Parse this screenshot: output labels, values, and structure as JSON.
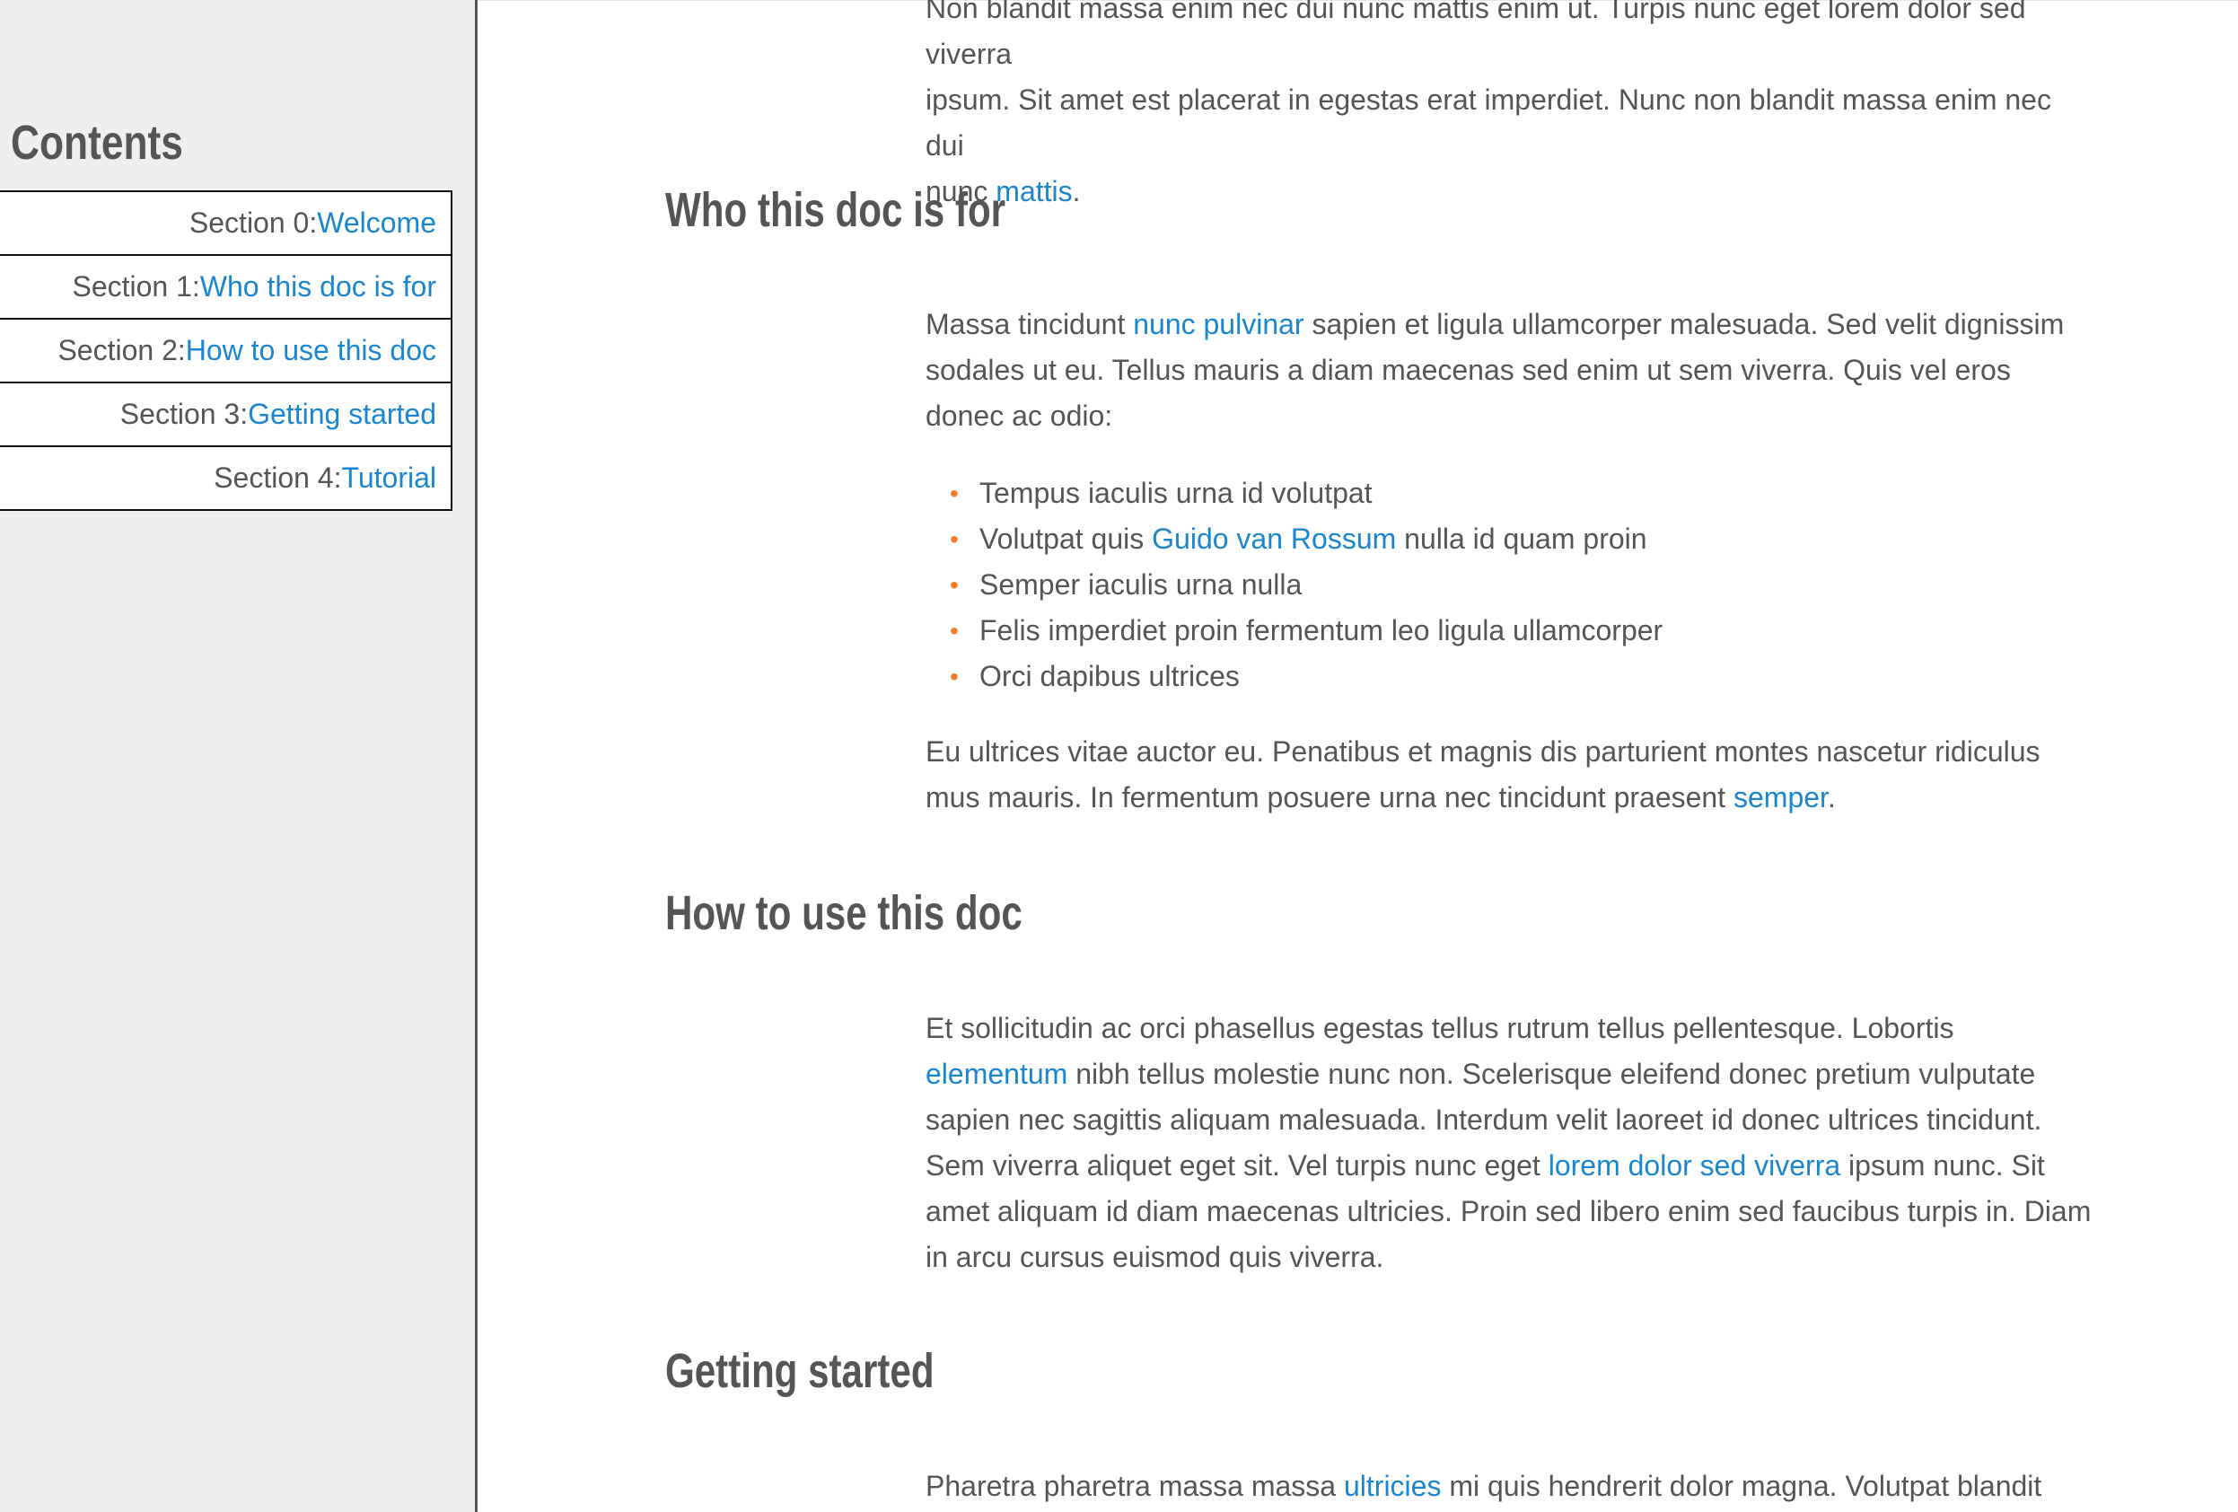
{
  "sidebar": {
    "title": "Contents",
    "items": [
      {
        "prefix": "Section 0: ",
        "link": "Welcome"
      },
      {
        "prefix": "Section 1: ",
        "link": "Who this doc is for"
      },
      {
        "prefix": "Section 2: ",
        "link": "How to use this doc"
      },
      {
        "prefix": "Section 3: ",
        "link": "Getting started"
      },
      {
        "prefix": "Section 4: ",
        "link": "Tutorial"
      }
    ]
  },
  "main": {
    "intro": {
      "line1": "Non blandit massa enim nec dui nunc mattis enim ut. Turpis nunc eget lorem dolor sed viverra",
      "line2": "ipsum. Sit amet est placerat in egestas erat imperdiet. Nunc non blandit massa enim nec dui",
      "line3_pre": "nunc ",
      "line3_link": "mattis",
      "line3_post": "."
    },
    "who": {
      "heading": "Who this doc is for",
      "p1_pre": "Massa tincidunt ",
      "p1_link": "nunc pulvinar",
      "p1_post": " sapien et ligula ullamcorper malesuada. Sed velit dignissim sodales ut eu. Tellus mauris a diam maecenas sed enim ut sem viverra. Quis vel eros donec ac odio:",
      "list": [
        {
          "pre": "Tempus iaculis urna id volutpat",
          "link": "",
          "post": ""
        },
        {
          "pre": "Volutpat quis ",
          "link": "Guido van Rossum",
          "post": " nulla id quam proin"
        },
        {
          "pre": "Semper iaculis urna nulla",
          "link": "",
          "post": ""
        },
        {
          "pre": "Felis imperdiet proin fermentum leo ligula ullamcorper",
          "link": "",
          "post": ""
        },
        {
          "pre": "Orci dapibus ultrices",
          "link": "",
          "post": ""
        }
      ],
      "p2_pre": "Eu ultrices vitae auctor eu. Penatibus et magnis dis parturient montes nascetur ridiculus mus mauris. In fermentum posuere urna nec tincidunt praesent ",
      "p2_link": "semper",
      "p2_post": "."
    },
    "howto": {
      "heading": "How to use this doc",
      "p_pre": "Et sollicitudin ac orci phasellus egestas tellus rutrum tellus pellentesque. Lobortis ",
      "p_link1": "elementum",
      "p_mid": " nibh tellus molestie nunc non. Scelerisque eleifend donec pretium vulputate sapien nec sagittis aliquam malesuada. Interdum velit laoreet id donec ultrices tincidunt. Sem viverra aliquet eget sit. Vel turpis nunc eget ",
      "p_link2": "lorem dolor sed viverra",
      "p_post": " ipsum nunc. Sit amet aliquam id diam maecenas ultricies. Proin sed libero enim sed faucibus turpis in. Diam in arcu cursus euismod quis viverra."
    },
    "getting_started": {
      "heading": "Getting started",
      "p_pre": "Pharetra pharetra massa massa ",
      "p_link": "ultricies",
      "p_post": " mi quis hendrerit dolor magna. Volutpat blandit"
    }
  },
  "colors": {
    "link": "#1a86d0",
    "bullet": "#f47b20",
    "text": "#555555",
    "sidebar_bg": "#efefef"
  }
}
